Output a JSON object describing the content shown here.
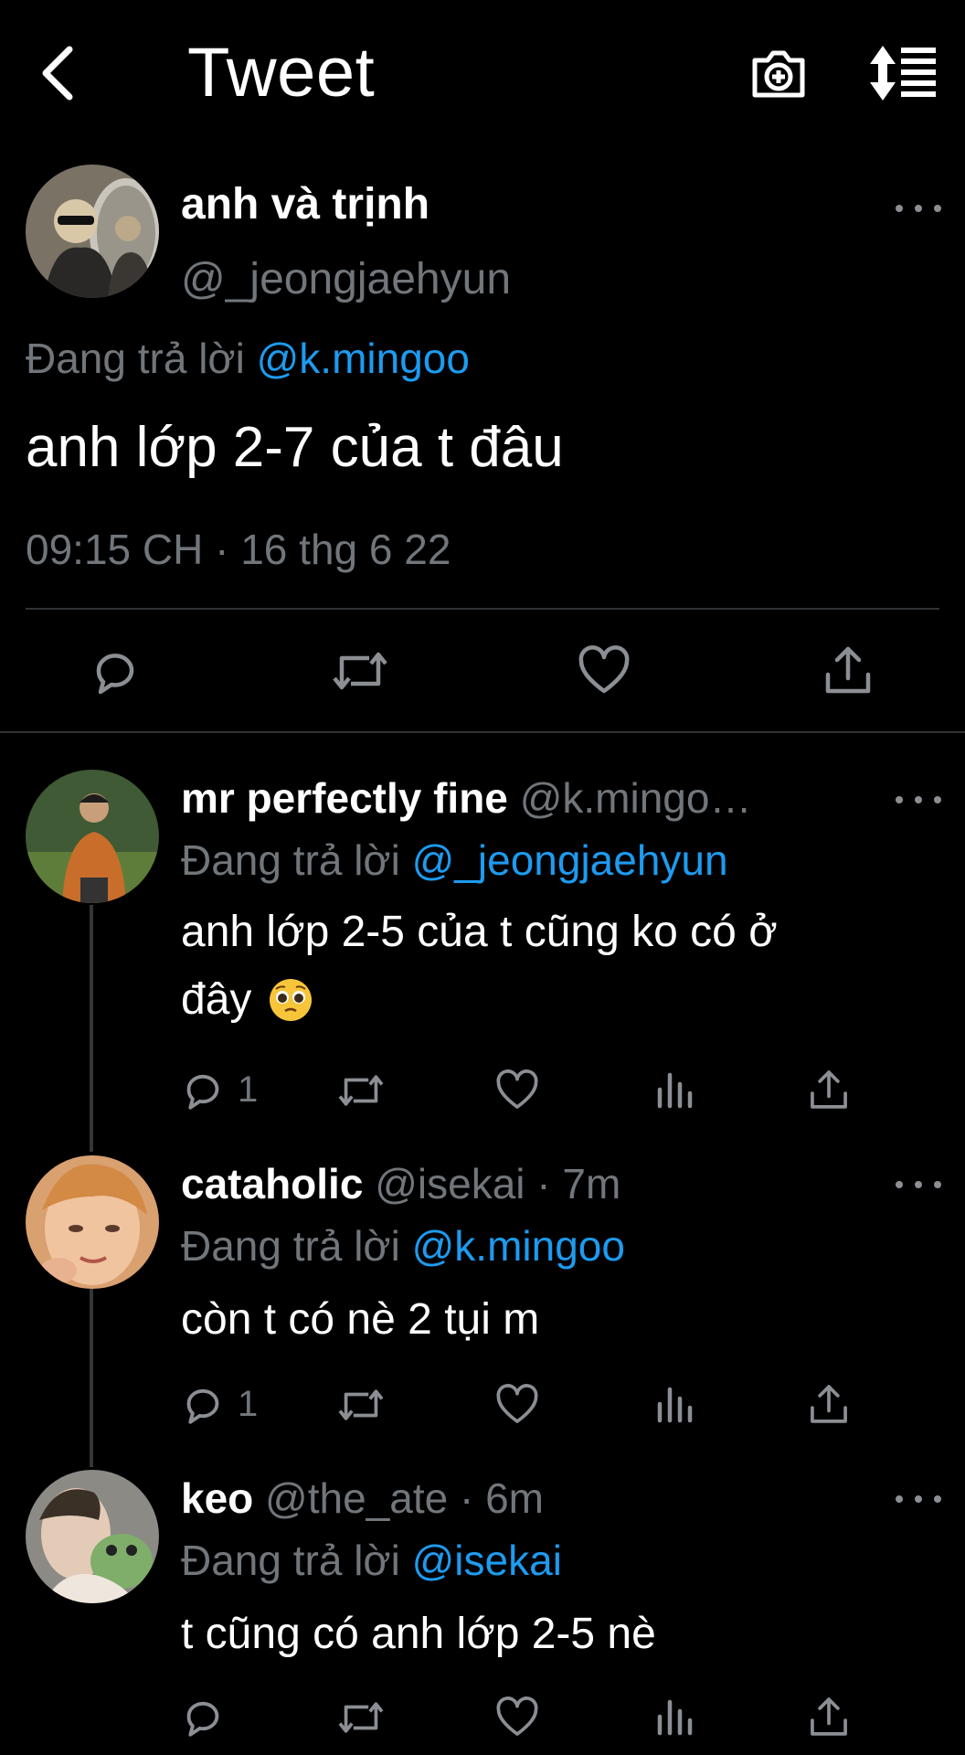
{
  "header": {
    "title": "Tweet"
  },
  "main_tweet": {
    "name": "anh và trịnh",
    "handle": "@_jeongjaehyun",
    "replying_prefix": "Đang trả lời",
    "replying_to": "@k.mingoo",
    "text": "anh lớp 2-7 của t đâu",
    "timestamp": "09:15 CH · 16 thg 6 22"
  },
  "replies": [
    {
      "name": "mr perfectly fine",
      "handle_time": "@k.mingo…",
      "replying_prefix": "Đang trả lời",
      "replying_to": "@_jeongjaehyun",
      "text_line1": "anh lớp 2-5 của t cũng ko có ở",
      "text_line2": "đây",
      "reply_count": "1"
    },
    {
      "name": "cataholic",
      "handle_time": "@isekai · 7m",
      "replying_prefix": "Đang trả lời",
      "replying_to": "@k.mingoo",
      "text_line1": "còn t có nè 2 tụi m",
      "reply_count": "1"
    },
    {
      "name": "keo",
      "handle_time": "@the_ate · 6m",
      "replying_prefix": "Đang trả lời",
      "replying_to": "@isekai",
      "text_line1": "t cũng có anh lớp 2-5 nè",
      "reply_count": ""
    }
  ],
  "colors": {
    "background": "#000000",
    "link": "#1d9bf0",
    "secondary": "#71767b",
    "divider": "#2f3336"
  }
}
